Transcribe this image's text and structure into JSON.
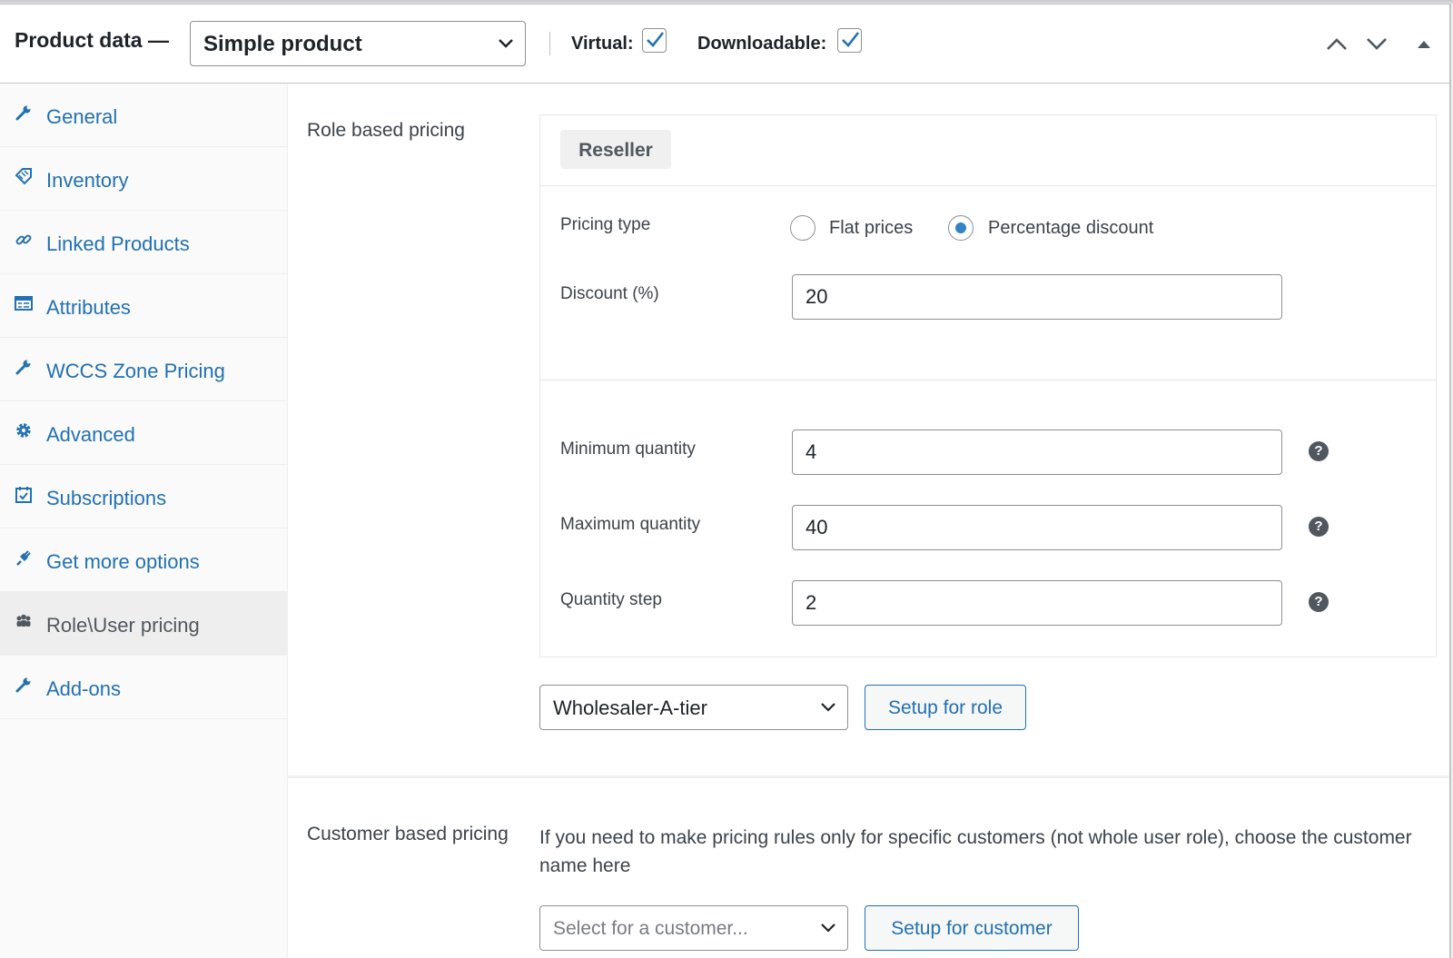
{
  "header": {
    "title": "Product data —",
    "product_type": "Simple product",
    "virtual_label": "Virtual:",
    "virtual_checked": true,
    "downloadable_label": "Downloadable:",
    "downloadable_checked": true,
    "icons": [
      "chevron-up-icon",
      "chevron-down-icon",
      "triangle-up-icon"
    ]
  },
  "tabs": [
    {
      "label": "General",
      "icon": "wrench-icon"
    },
    {
      "label": "Inventory",
      "icon": "tag-icon"
    },
    {
      "label": "Linked Products",
      "icon": "link-icon"
    },
    {
      "label": "Attributes",
      "icon": "list-icon"
    },
    {
      "label": "WCCS Zone Pricing",
      "icon": "wrench-icon"
    },
    {
      "label": "Advanced",
      "icon": "gear-icon"
    },
    {
      "label": "Subscriptions",
      "icon": "calendar-check-icon"
    },
    {
      "label": "Get more options",
      "icon": "plugin-icon"
    },
    {
      "label": "Role\\User pricing",
      "icon": "users-icon",
      "active": true
    },
    {
      "label": "Add-ons",
      "icon": "wrench-icon"
    }
  ],
  "role_pricing": {
    "label": "Role based pricing",
    "role_name": "Reseller",
    "pricing_type_label": "Pricing type",
    "pricing_options": [
      "Flat prices",
      "Percentage discount"
    ],
    "selected_pricing": "Percentage discount",
    "discount_label": "Discount (%)",
    "discount_value": "20",
    "min_qty_label": "Minimum quantity",
    "min_qty_value": "4",
    "max_qty_label": "Maximum quantity",
    "max_qty_value": "40",
    "qty_step_label": "Quantity step",
    "qty_step_value": "2",
    "help_symbol": "?",
    "role_select_value": "Wholesaler-A-tier",
    "setup_role_button": "Setup for role"
  },
  "customer_pricing": {
    "label": "Customer based pricing",
    "description": "If you need to make pricing rules only for specific customers (not whole user role), choose the customer name here",
    "select_placeholder": "Select for a customer...",
    "setup_customer_button": "Setup for customer"
  },
  "colors": {
    "link": "#2271b1",
    "radio_selected": "#3582c4",
    "text": "#1d2327"
  }
}
